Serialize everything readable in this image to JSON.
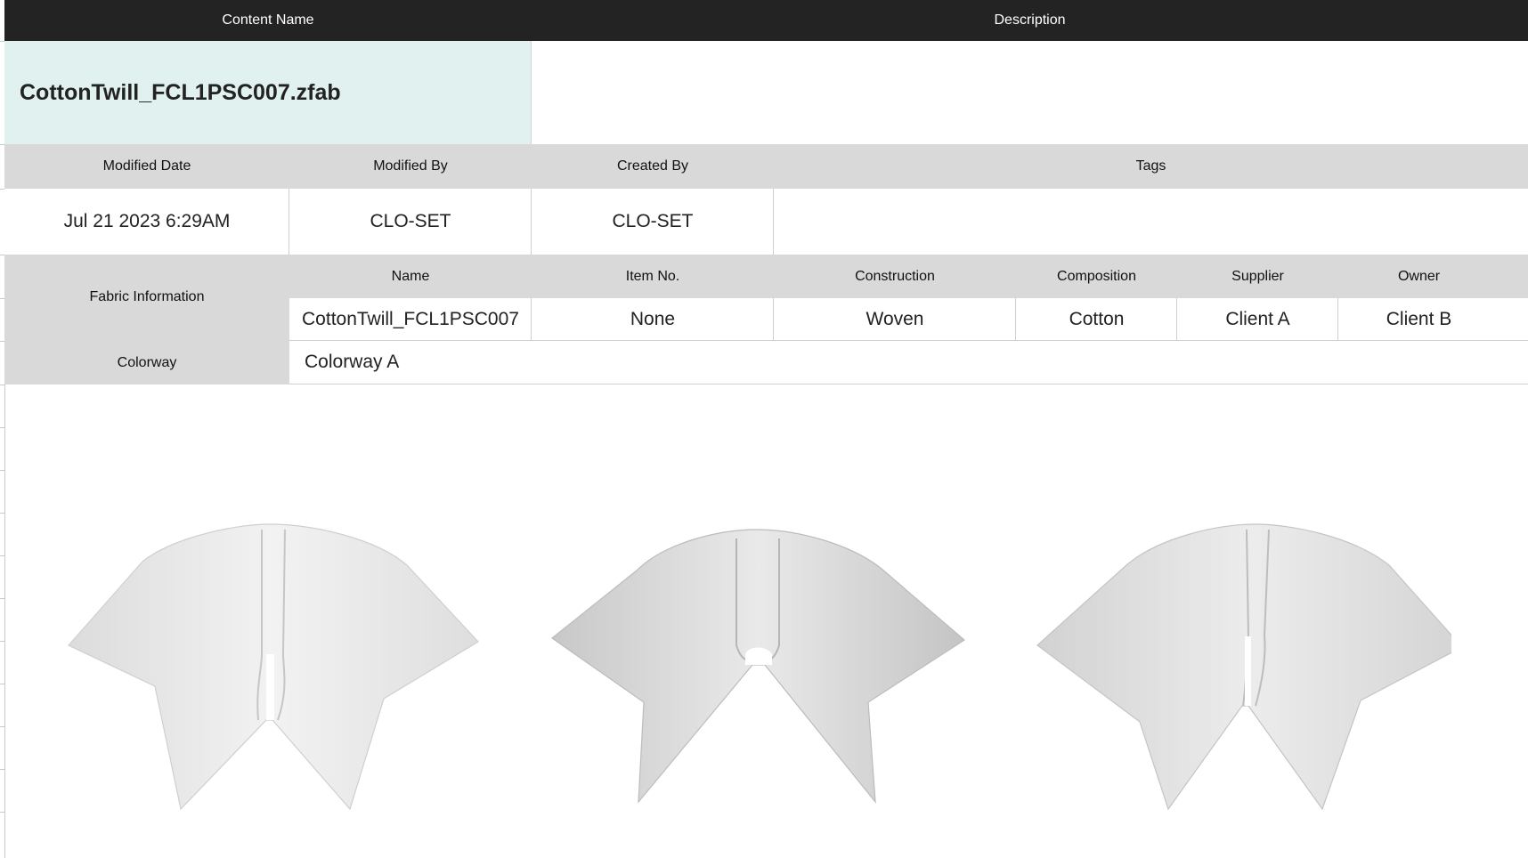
{
  "header": {
    "content_name_label": "Content Name",
    "description_label": "Description"
  },
  "content": {
    "file_name": "CottonTwill_FCL1PSC007.zfab",
    "description": ""
  },
  "meta": {
    "headers": {
      "modified_date": "Modified Date",
      "modified_by": "Modified By",
      "created_by": "Created By",
      "tags": "Tags"
    },
    "values": {
      "modified_date": "Jul 21 2023  6:29AM",
      "modified_by": "CLO-SET",
      "created_by": "CLO-SET",
      "tags": ""
    }
  },
  "fabric": {
    "section_label": "Fabric Information",
    "headers": {
      "name": "Name",
      "item_no": "Item No.",
      "construction": "Construction",
      "composition": "Composition",
      "supplier": "Supplier",
      "owner": "Owner"
    },
    "values": {
      "name": "CottonTwill_FCL1PSC007",
      "item_no": "None",
      "construction": "Woven",
      "composition": "Cotton",
      "supplier": "Client A",
      "owner": "Client B"
    }
  },
  "colorway": {
    "label": "Colorway",
    "value": "Colorway A"
  },
  "previews": [
    {
      "name": "fabric-drape-preview-front",
      "color": "#eeeeee"
    },
    {
      "name": "fabric-drape-preview-back",
      "color": "#d8d8d8"
    },
    {
      "name": "fabric-drape-preview-side",
      "color": "#e0e0e0"
    }
  ]
}
